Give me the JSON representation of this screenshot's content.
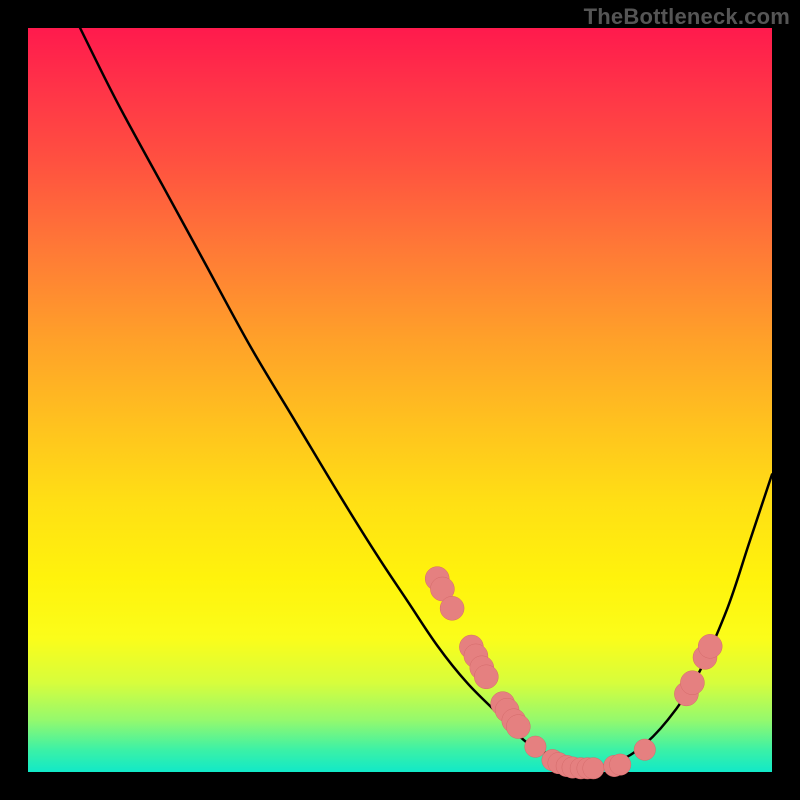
{
  "watermark": "TheBottleneck.com",
  "colors": {
    "background": "#000000",
    "gradient_top": "#ff1a4d",
    "gradient_bottom": "#11e9c8",
    "curve": "#000000",
    "marker_fill": "#e58080",
    "marker_stroke": "#d46a6a"
  },
  "chart_data": {
    "type": "line",
    "title": "",
    "xlabel": "",
    "ylabel": "",
    "xlim": [
      0,
      100
    ],
    "ylim": [
      0,
      100
    ],
    "grid": false,
    "legend": false,
    "series": [
      {
        "name": "bottleneck-curve",
        "x": [
          7,
          12,
          18,
          24,
          30,
          36,
          42,
          47,
          51,
          55,
          59,
          63,
          67,
          71,
          75,
          78,
          82,
          86,
          90,
          94,
          97,
          100
        ],
        "y": [
          100,
          90,
          79,
          68,
          57,
          47,
          37,
          29,
          23,
          17,
          12,
          8,
          4,
          2,
          1,
          1,
          3,
          7,
          13,
          22,
          31,
          40
        ]
      }
    ],
    "markers": [
      {
        "x": 55.0,
        "y": 26.0,
        "r": 1.2
      },
      {
        "x": 55.7,
        "y": 24.6,
        "r": 1.2
      },
      {
        "x": 57.0,
        "y": 22.0,
        "r": 1.2
      },
      {
        "x": 59.6,
        "y": 16.8,
        "r": 1.2
      },
      {
        "x": 60.2,
        "y": 15.6,
        "r": 1.2
      },
      {
        "x": 61.0,
        "y": 14.0,
        "r": 1.2
      },
      {
        "x": 61.6,
        "y": 12.8,
        "r": 1.2
      },
      {
        "x": 63.8,
        "y": 9.2,
        "r": 1.2
      },
      {
        "x": 64.4,
        "y": 8.3,
        "r": 1.2
      },
      {
        "x": 65.3,
        "y": 6.9,
        "r": 1.2
      },
      {
        "x": 65.9,
        "y": 6.1,
        "r": 1.2
      },
      {
        "x": 68.2,
        "y": 3.4,
        "r": 1.0
      },
      {
        "x": 70.5,
        "y": 1.6,
        "r": 1.0
      },
      {
        "x": 71.3,
        "y": 1.2,
        "r": 1.0
      },
      {
        "x": 72.4,
        "y": 0.8,
        "r": 1.0
      },
      {
        "x": 73.2,
        "y": 0.6,
        "r": 1.0
      },
      {
        "x": 74.3,
        "y": 0.5,
        "r": 1.0
      },
      {
        "x": 75.2,
        "y": 0.5,
        "r": 1.0
      },
      {
        "x": 76.0,
        "y": 0.5,
        "r": 1.0
      },
      {
        "x": 78.8,
        "y": 0.8,
        "r": 1.0
      },
      {
        "x": 79.6,
        "y": 1.0,
        "r": 1.0
      },
      {
        "x": 82.9,
        "y": 3.0,
        "r": 1.0
      },
      {
        "x": 88.5,
        "y": 10.5,
        "r": 1.2
      },
      {
        "x": 89.3,
        "y": 12.0,
        "r": 1.2
      },
      {
        "x": 91.0,
        "y": 15.4,
        "r": 1.2
      },
      {
        "x": 91.7,
        "y": 16.9,
        "r": 1.2
      }
    ],
    "note": "Values estimated from pixel positions; chart has no axes, ticks, or legend."
  }
}
